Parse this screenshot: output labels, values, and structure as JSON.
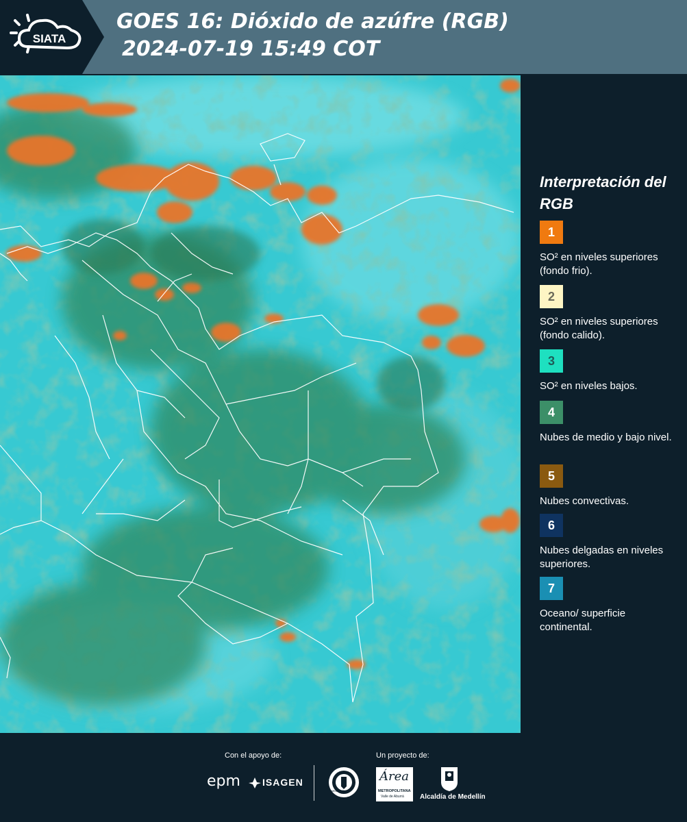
{
  "header": {
    "logo_text": "SIATA",
    "title_line1": "GOES 16: Dióxido de azúfre (RGB)",
    "title_line2": "2024-07-19 15:49 COT"
  },
  "legend": {
    "title": "Interpretación del RGB",
    "items": [
      {
        "number": "1",
        "color": "#f07a10",
        "text": "SO² en niveles superiores (fondo frio)."
      },
      {
        "number": "2",
        "color": "#fdf5c4",
        "text": "SO² en niveles superiores (fondo calido)."
      },
      {
        "number": "3",
        "color": "#1ee0c0",
        "text": "SO² en niveles bajos."
      },
      {
        "number": "4",
        "color": "#3c8f68",
        "text": "Nubes de medio y bajo nivel."
      },
      {
        "number": "5",
        "color": "#8a5a10",
        "text": "Nubes convectivas."
      },
      {
        "number": "6",
        "color": "#0f3360",
        "text": "Nubes delgadas en niveles superiores."
      },
      {
        "number": "7",
        "color": "#1a8fb3",
        "text": "Oceano/ superficie continental."
      }
    ]
  },
  "footer": {
    "support_label": "Con el apoyo de:",
    "project_label": "Un proyecto de:",
    "sponsor1": "epm",
    "sponsor2": "ISAGEN",
    "area_logo": "Área",
    "area_sub": "METROPOLITANA",
    "area_sub2": "Valle de Aburrá",
    "alcaldia": "Alcaldía de Medellín",
    "medellin_seal": "MEDELLÍN"
  }
}
